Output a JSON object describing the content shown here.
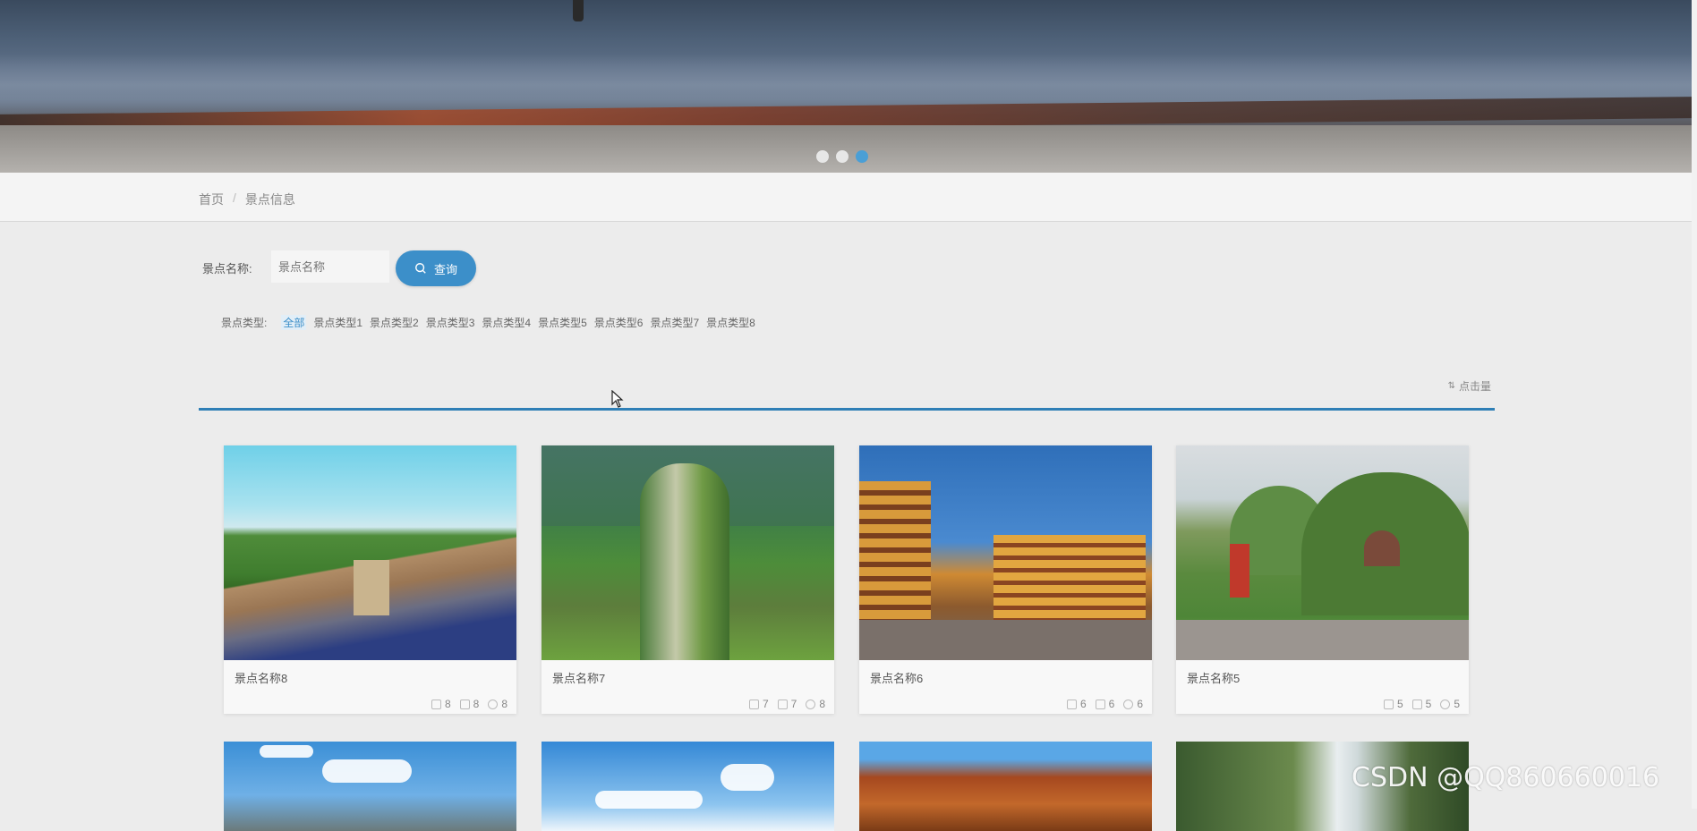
{
  "banner": {
    "slides": 3,
    "active_slide": 3
  },
  "breadcrumb": {
    "home": "首页",
    "separator": "/",
    "current": "景点信息"
  },
  "search": {
    "label": "景点名称:",
    "placeholder": "景点名称",
    "button_label": "查询"
  },
  "types": {
    "label": "景点类型:",
    "items": [
      "全部",
      "景点类型1",
      "景点类型2",
      "景点类型3",
      "景点类型4",
      "景点类型5",
      "景点类型6",
      "景点类型7",
      "景点类型8"
    ],
    "active_index": 0
  },
  "sort": {
    "label": "点击量"
  },
  "cards": [
    {
      "name": "景点名称8",
      "stats": [
        "8",
        "8",
        "8"
      ]
    },
    {
      "name": "景点名称7",
      "stats": [
        "7",
        "7",
        "8"
      ]
    },
    {
      "name": "景点名称6",
      "stats": [
        "6",
        "6",
        "6"
      ]
    },
    {
      "name": "景点名称5",
      "stats": [
        "5",
        "5",
        "5"
      ]
    }
  ],
  "watermark": "CSDN @QQ860660016",
  "colors": {
    "accent": "#3c8fc9",
    "background": "#ececec"
  }
}
